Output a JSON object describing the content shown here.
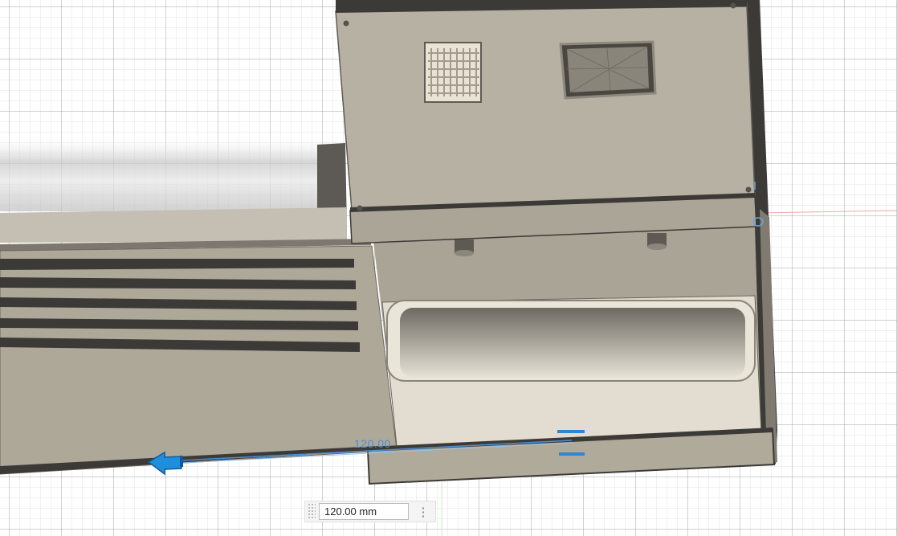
{
  "viewport": {
    "dimension_label": "120.00",
    "dimension_input": {
      "value": "120.00 mm",
      "menu_icon": "vertical-ellipsis-icon"
    }
  },
  "colors": {
    "model_body": "#aea899",
    "model_dark": "#3c3a37",
    "tray_inner": "#e2ddd0",
    "dimension_blue": "#4a8fd6",
    "manipulator_arrow": "#1f8fdc",
    "x_axis": "#f2a8a8",
    "y_axis": "#8ecf8e"
  }
}
